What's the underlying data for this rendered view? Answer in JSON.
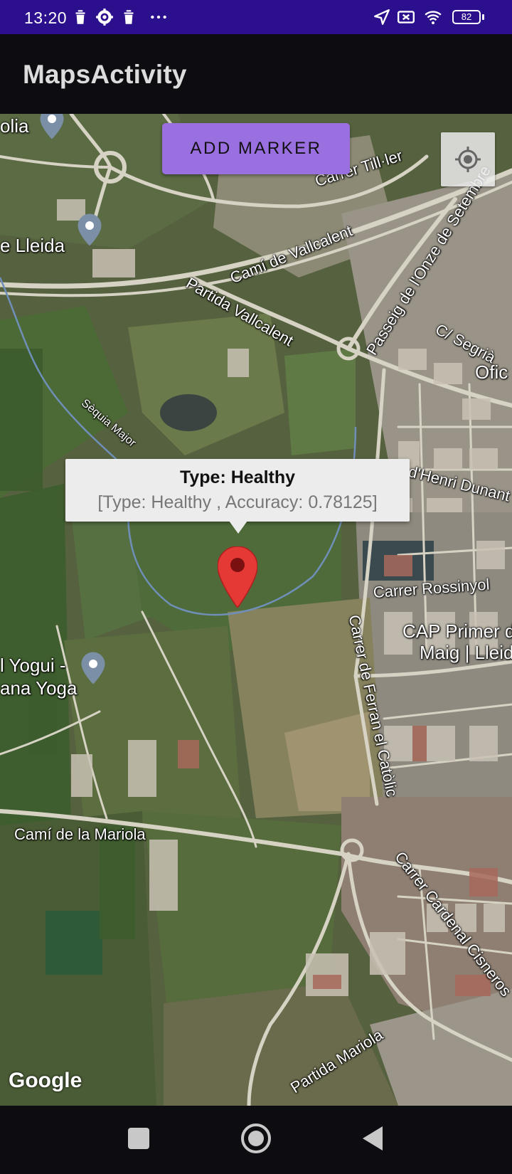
{
  "status_bar": {
    "time": "13:20",
    "battery": "82",
    "left_icons": [
      "trash-icon",
      "gear-icon",
      "trash-icon",
      "more-dots-icon"
    ],
    "right_icons": [
      "location-arrow-icon",
      "no-sim-icon",
      "wifi-icon",
      "battery-icon"
    ]
  },
  "app_bar": {
    "title": "MapsActivity"
  },
  "map": {
    "add_marker_label": "ADD MARKER",
    "info_window": {
      "title": "Type:  Healthy",
      "snippet": "[Type:  Healthy ,  Accuracy: 0.78125]"
    },
    "labels": {
      "olia": "olia",
      "e_lleida": "e Lleida",
      "carrer_tiller": "Carrer Till·ler",
      "cami_vallcalent": "Camí de Vallcalent",
      "passeig_onze": "Passeig de l'Onze de Setembre",
      "partida_vallcalent": "Partida Vallcalent",
      "c_segria": "C/ Segrià",
      "ofic": "Ofic",
      "sequia_major": "Sèquia Major",
      "henri_dunant": "d'Henri Dunant",
      "carrer_rossinyol": "Carrer Rossinyol",
      "cap_primer_1": "CAP Primer d",
      "cap_primer_2": "Maig | Lleid",
      "yogui_1": "l Yogui -",
      "yogui_2": "ana Yoga",
      "ferran_catolic": "Carrer de Ferran el Catòlic",
      "cami_mariola": "Camí de la Mariola",
      "cardenal_cisneros": "Carrer Cardenal Cisneros",
      "partida_mariola": "Partida Mariola"
    },
    "attribution": "Google"
  },
  "nav_bar": {
    "buttons": [
      "recents-button",
      "home-button",
      "back-button"
    ]
  },
  "colors": {
    "status_bar": "#2c0f8c",
    "app_bar": "#0d0c10",
    "button": "#9a6fe0",
    "marker": "#e53935"
  }
}
